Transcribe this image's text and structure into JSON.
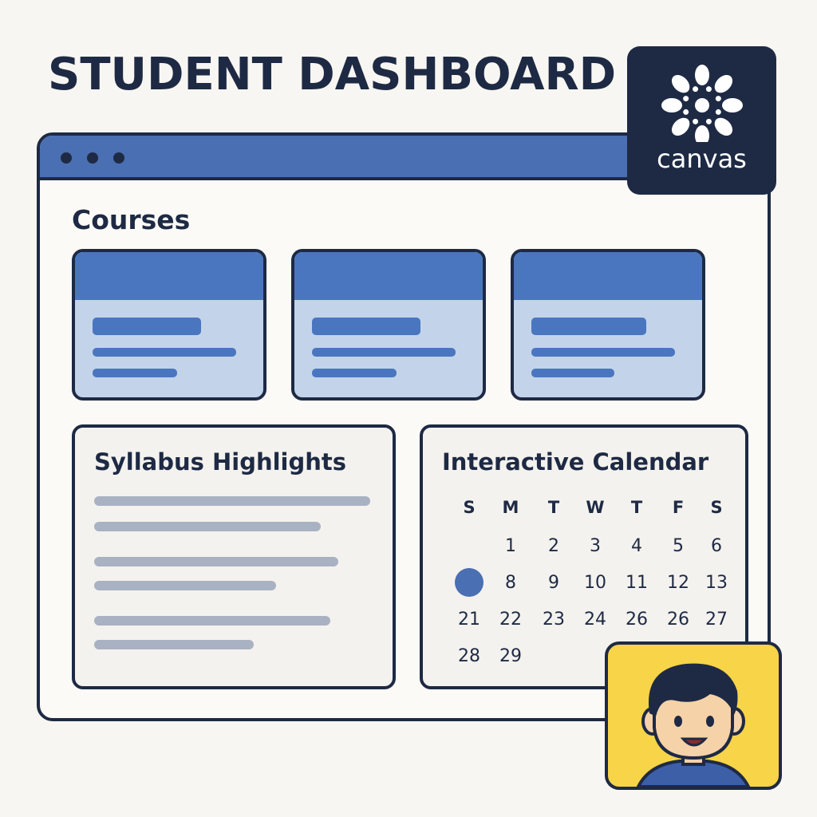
{
  "page": {
    "title": "STUDENT DASHBOARD"
  },
  "brand": {
    "name": "canvas",
    "icon": "canvas-logo-icon",
    "color": "#1e2a44"
  },
  "colors": {
    "accent": "#4a6fb3",
    "card_fill": "#c3d4ea",
    "avatar_bg": "#f7d448"
  },
  "courses": {
    "heading": "Courses",
    "cards": [
      {},
      {},
      {}
    ]
  },
  "syllabus": {
    "heading": "Syllabus Highlights"
  },
  "calendar": {
    "heading": "Interactive Calendar",
    "weekdays": [
      "S",
      "M",
      "T",
      "W",
      "T",
      "F",
      "S"
    ],
    "weeks": [
      [
        "",
        "1",
        "2",
        "3",
        "4",
        "5",
        "6"
      ],
      [
        "",
        "8",
        "9",
        "10",
        "11",
        "12",
        "13"
      ],
      [
        "21",
        "22",
        "23",
        "24",
        "26",
        "26",
        "27"
      ],
      [
        "28",
        "29",
        "",
        "",
        "",
        "",
        ""
      ]
    ],
    "selected": {
      "week": 1,
      "day": 0
    }
  },
  "user": {
    "avatar": "student-avatar-icon"
  }
}
